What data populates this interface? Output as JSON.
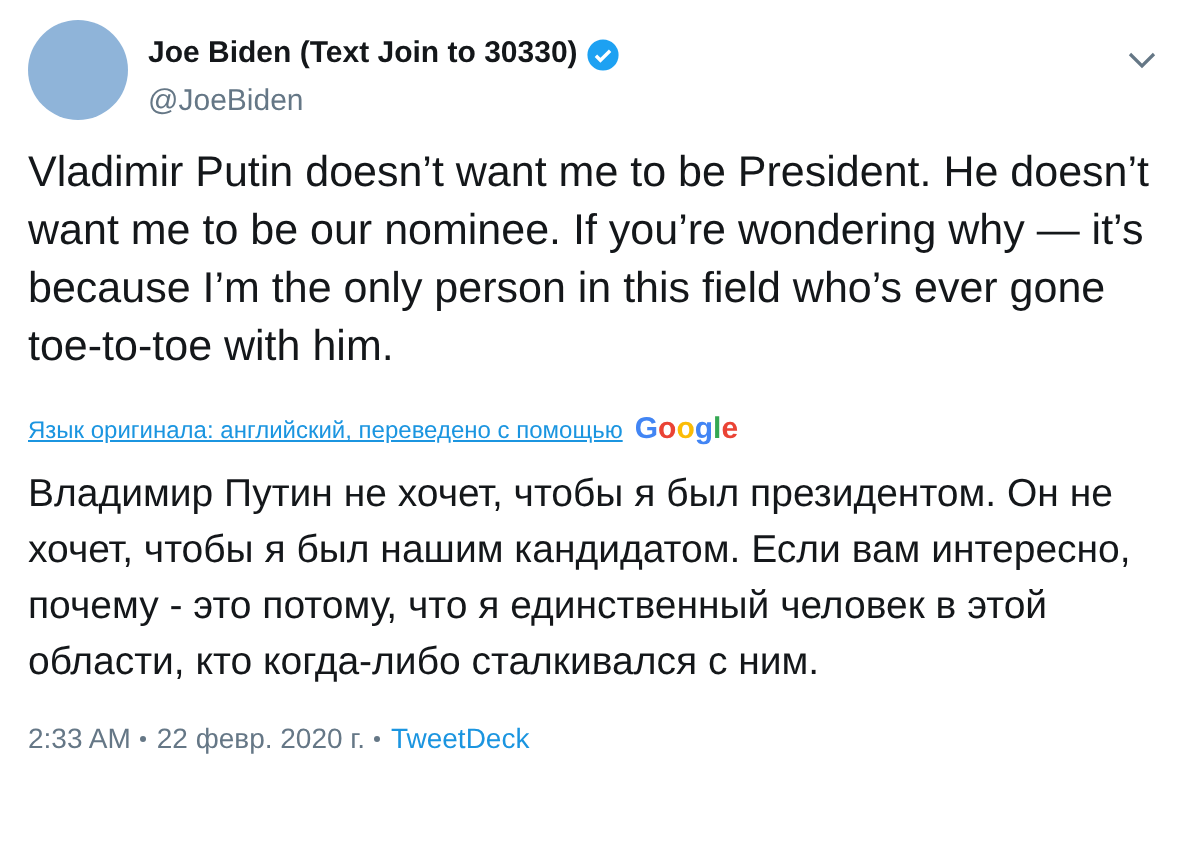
{
  "author": {
    "name": "Joe Biden (Text Join to 30330)",
    "verified": true,
    "handle": "@JoeBiden"
  },
  "tweet_text": "Vladimir Putin doesn’t want me to be President. He doesn’t want me to be our nominee. If you’re wondering why — it’s because I’m the only person in this field who’s ever gone toe-to-toe with him.",
  "translation": {
    "link": "Язык оригинала: английский, переведено с помощью",
    "logo": "Google",
    "text": "Владимир Путин не хочет, чтобы я был президентом. Он не хочет, чтобы я был нашим кандидатом. Если вам интересно, почему - это потому, что я единственный человек в этой области, кто когда-либо сталкивался с ним."
  },
  "footer": {
    "time": "2:33 AM",
    "date": "22 февр. 2020 г.",
    "source": "TweetDeck"
  }
}
